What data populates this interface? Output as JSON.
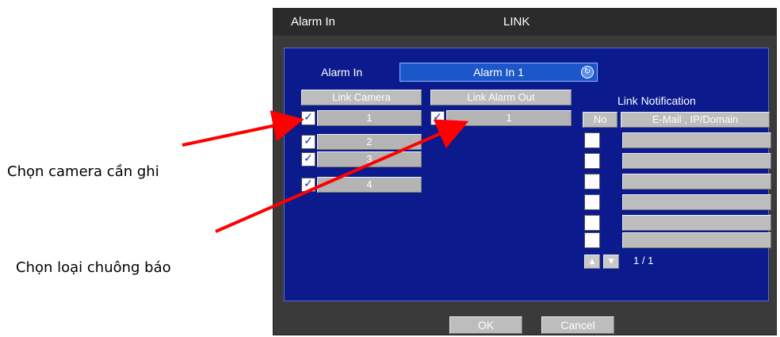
{
  "annotations": {
    "camera": "Chọn camera cần ghi",
    "alarm": "Chọn loại chuông báo"
  },
  "window": {
    "title_left": "Alarm In",
    "title_center": "LINK"
  },
  "alarm_in": {
    "label": "Alarm In",
    "value": "Alarm In 1"
  },
  "link_camera": {
    "header": "Link Camera",
    "items": [
      {
        "label": "1",
        "checked": true
      },
      {
        "label": "2",
        "checked": true
      },
      {
        "label": "3",
        "checked": true
      },
      {
        "label": "4",
        "checked": true
      }
    ]
  },
  "link_alarm_out": {
    "header": "Link Alarm Out",
    "items": [
      {
        "label": "1",
        "checked": true
      }
    ]
  },
  "link_notification": {
    "title": "Link Notification",
    "col_no": "No",
    "col_target": "E-Mail , IP/Domain",
    "rows": 6,
    "page": "1 / 1"
  },
  "buttons": {
    "ok": "OK",
    "cancel": "Cancel"
  },
  "colors": {
    "panel": "#0b1a8c",
    "arrow": "#ff0000"
  }
}
